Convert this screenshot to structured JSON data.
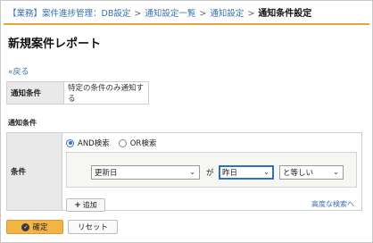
{
  "breadcrumb": {
    "items": [
      "【業務】案件進捗管理：DB設定",
      "通知設定一覧",
      "通知設定"
    ],
    "separator": ">",
    "current": "通知条件設定"
  },
  "page": {
    "title": "新規案件レポート",
    "back_link": "«戻る"
  },
  "info": {
    "label": "通知条件",
    "value": "特定の条件のみ通知する"
  },
  "conditions": {
    "heading": "通知条件",
    "row_label": "条件",
    "radio_and": "AND検索",
    "radio_or": "OR検索",
    "selected": "and",
    "field_select": "更新日",
    "particle": "が",
    "value_select": "昨日",
    "operator_select": "と等しい",
    "add_button": "追加",
    "advanced_link": "高度な検索へ"
  },
  "actions": {
    "confirm": "確定",
    "reset": "リセット"
  },
  "colors": {
    "accent": "#e8a23a",
    "link": "#3a6fb0",
    "confirm_bg": "#f2b347"
  }
}
